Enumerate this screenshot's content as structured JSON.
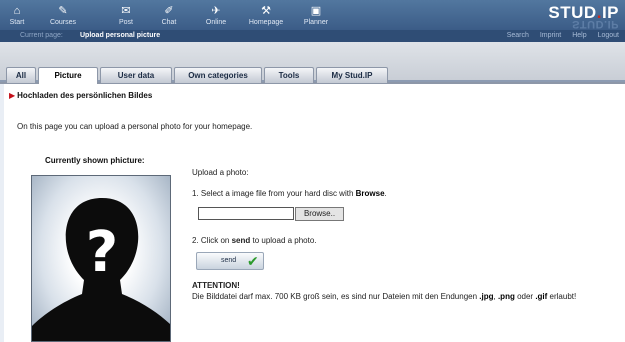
{
  "nav": {
    "items": [
      {
        "label": "Start",
        "icon": "home-icon",
        "glyph": "⌂"
      },
      {
        "label": "Courses",
        "icon": "courses-icon",
        "glyph": "✎"
      },
      {
        "label": "Post",
        "icon": "mail-icon",
        "glyph": "✉"
      },
      {
        "label": "Chat",
        "icon": "chat-icon",
        "glyph": "✐"
      },
      {
        "label": "Online",
        "icon": "online-icon",
        "glyph": "✈"
      },
      {
        "label": "Homepage",
        "icon": "tools-icon",
        "glyph": "⚒"
      },
      {
        "label": "Planner",
        "icon": "planner-icon",
        "glyph": "▣"
      }
    ],
    "logo_main": "STUD",
    "logo_dot": ".",
    "logo_end": "IP",
    "logo_reflection": "STUD.IP"
  },
  "subbar": {
    "label": "Current page:",
    "page": "Upload personal picture",
    "links": [
      "Search",
      "Imprint",
      "Help",
      "Logout"
    ]
  },
  "tabs": [
    "All",
    "Picture",
    "User data",
    "Own categories",
    "Tools",
    "My Stud.IP"
  ],
  "active_tab": "Picture",
  "content": {
    "section_title": "Hochladen des persönlichen Bildes",
    "intro": "On this page you can upload a personal photo for your homepage.",
    "shown_title": "Currently shown phicture:",
    "upload_title": "Upload a photo:",
    "step1_prefix": "1. Select a image file from your hard disc with ",
    "step1_bold": "Browse",
    "step1_suffix": ".",
    "file_value": "",
    "browse_label": "Browse..",
    "step2_prefix": "2. Click on ",
    "step2_bold": "send",
    "step2_suffix": " to upload a photo.",
    "send_label": "send",
    "attention": "ATTENTION!",
    "att_prefix": "Die Bilddatei darf max. 700 KB groß sein, es sind nur Dateien mit den Endungen ",
    "att_jpg": ".jpg",
    "att_sep1": ", ",
    "att_png": ".png",
    "att_sep2": " oder ",
    "att_gif": ".gif",
    "att_suffix": " erlaubt!"
  }
}
